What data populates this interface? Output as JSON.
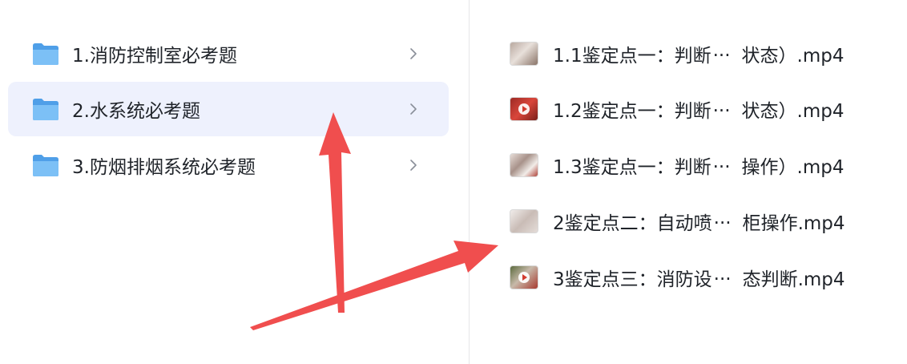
{
  "folders": [
    {
      "label": "1.消防控制室必考题",
      "selected": false
    },
    {
      "label": "2.水系统必考题",
      "selected": true
    },
    {
      "label": "3.防烟排烟系统必考题",
      "selected": false
    }
  ],
  "files": [
    {
      "head": "1.1鉴定点一：判断",
      "ellipsis": "...",
      "tail": "状态）.mp4",
      "thumb_icon": "video-thumbnail-icon"
    },
    {
      "head": "1.2鉴定点一：判断",
      "ellipsis": "...",
      "tail": "状态）.mp4",
      "thumb_icon": "video-thumbnail-icon"
    },
    {
      "head": "1.3鉴定点一：判断",
      "ellipsis": "...",
      "tail": "操作）.mp4",
      "thumb_icon": "video-thumbnail-icon"
    },
    {
      "head": "2鉴定点二：自动喷",
      "ellipsis": "...",
      "tail": "柜操作.mp4",
      "thumb_icon": "video-thumbnail-icon"
    },
    {
      "head": "3鉴定点三：消防设",
      "ellipsis": "...",
      "tail": "态判断.mp4",
      "thumb_icon": "video-thumbnail-icon"
    }
  ],
  "icons": {
    "folder": "folder-icon",
    "chevron": "chevron-right-icon",
    "annotation": "red-arrow-icon"
  },
  "colors": {
    "selected_row_bg": "#eef1fd",
    "folder_blue": "#5aa9ee",
    "arrow_red": "#f04e4e",
    "divider": "#e6e6e9"
  }
}
